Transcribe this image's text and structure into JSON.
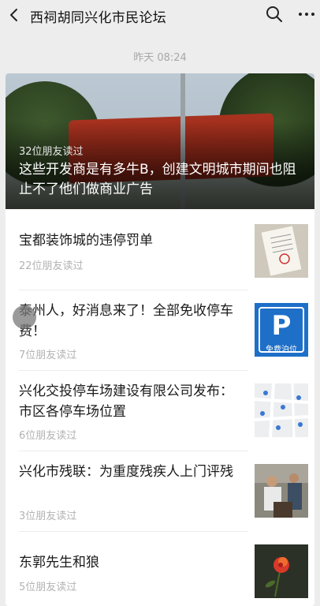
{
  "header": {
    "title": "西祠胡同兴化市民论坛"
  },
  "timestamp": "昨天 08:24",
  "hero": {
    "reads": "32位朋友读过",
    "headline": "这些开发商是有多牛B，创建文明城市期间也阻止不了他们做商业广告"
  },
  "articles": [
    {
      "title": "宝都装饰城的违停罚单",
      "reads": "22位朋友读过"
    },
    {
      "title": "泰州人，好消息来了！全部免收停车费！",
      "reads": "7位朋友读过",
      "thumb_caption": "免费泊位"
    },
    {
      "title": "兴化交投停车场建设有限公司发布：市区各停车场位置",
      "reads": "6位朋友读过"
    },
    {
      "title": "兴化市残联：为重度残疾人上门评残",
      "reads": "3位朋友读过"
    },
    {
      "title": "东郭先生和狼",
      "reads": "5位朋友读过"
    }
  ],
  "colors": {
    "background": "#ededed",
    "card": "#ffffff",
    "parking_blue": "#1e6fc8"
  }
}
